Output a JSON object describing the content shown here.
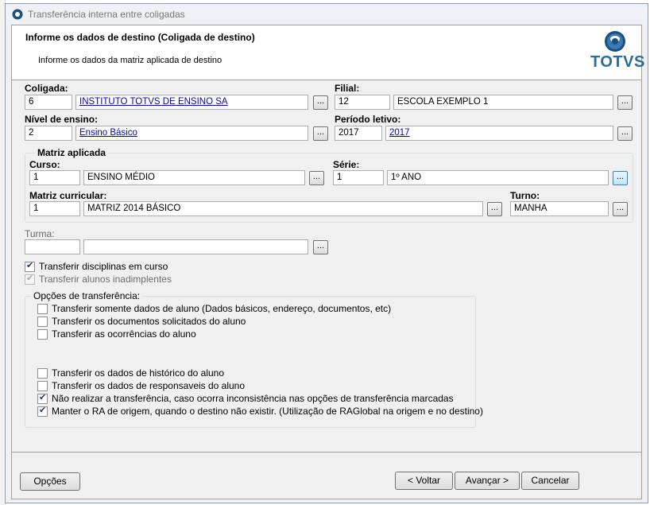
{
  "window": {
    "title": "Transferência interna entre coligadas"
  },
  "header": {
    "title": "Informe os dados de destino (Coligada de destino)",
    "subtitle": "Informe os dados da matriz aplicada de destino",
    "logo_text": "TOTVS"
  },
  "fields": {
    "coligada": {
      "label": "Coligada:",
      "code": "6",
      "desc": "INSTITUTO TOTVS DE ENSINO SA"
    },
    "filial": {
      "label": "Filial:",
      "code": "12",
      "desc": "ESCOLA EXEMPLO 1"
    },
    "nivel": {
      "label": "Nível de ensino:",
      "code": "2",
      "desc": "Ensino Básico"
    },
    "periodo": {
      "label": "Período letivo:",
      "code": "2017",
      "desc": "2017"
    },
    "matriz_group": "Matriz aplicada",
    "curso": {
      "label": "Curso:",
      "code": "1",
      "desc": "ENSINO MÉDIO"
    },
    "serie": {
      "label": "Série:",
      "code": "1",
      "desc": "1º ANO"
    },
    "matriz": {
      "label": "Matriz curricular:",
      "code": "1",
      "desc": "MATRIZ 2014 BÁSICO"
    },
    "turno": {
      "label": "Turno:",
      "value": "MANHA"
    },
    "turma": {
      "label": "Turma:",
      "code": "",
      "desc": ""
    },
    "dots": "..."
  },
  "checks": {
    "disciplinas": {
      "label": "Transferir disciplinas em curso",
      "checked": true
    },
    "inadimplentes": {
      "label": "Transferir alunos inadimplentes",
      "checked": true,
      "disabled": true
    }
  },
  "options": {
    "title": "Opções de transferência:",
    "items": [
      {
        "label": "Transferir somente dados de aluno (Dados básicos, endereço, documentos, etc)",
        "checked": false
      },
      {
        "label": "Transferir os documentos solicitados do aluno",
        "checked": false
      },
      {
        "label": "Transferir as ocorrências do aluno",
        "checked": false
      },
      {
        "label": "Transferir os dados de histórico do aluno",
        "checked": false
      },
      {
        "label": "Transferir os dados de responsaveis do aluno",
        "checked": false
      },
      {
        "label": "Não realizar a transferência, caso ocorra inconsistência nas opções de transferência marcadas",
        "checked": true
      },
      {
        "label": "Manter o RA de origem, quando o destino não existir. (Utilização de RAGlobal na origem e no destino)",
        "checked": true
      }
    ]
  },
  "buttons": {
    "opcoes": "Opções",
    "voltar": "< Voltar",
    "avancar": "Avançar >",
    "cancelar": "Cancelar"
  },
  "colors": {
    "logo_blue": "#2b6c9e",
    "link": "#0000cc",
    "focus_border": "#3c7fb1"
  }
}
